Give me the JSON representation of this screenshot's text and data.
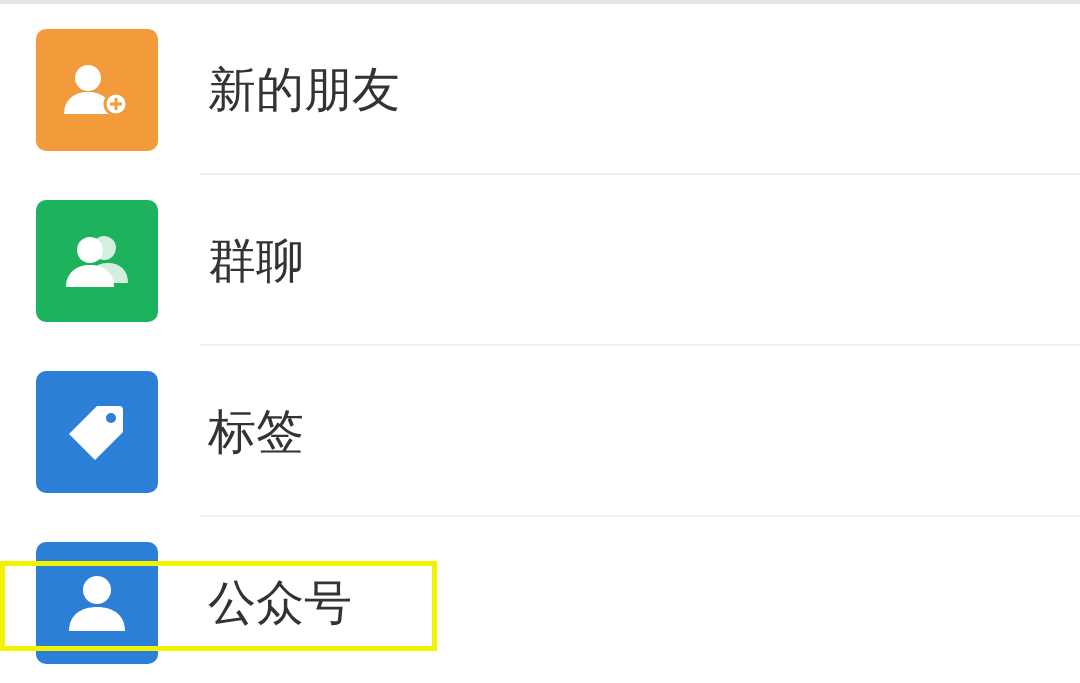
{
  "contact_menu": [
    {
      "kind": "new-friends",
      "label": "新的朋友",
      "color": "#f39a3b",
      "highlighted": false
    },
    {
      "kind": "group-chat",
      "label": "群聊",
      "color": "#1db35d",
      "highlighted": false
    },
    {
      "kind": "tags",
      "label": "标签",
      "color": "#2c7fd6",
      "highlighted": false
    },
    {
      "kind": "official-accounts",
      "label": "公众号",
      "color": "#2c7fd6",
      "highlighted": true
    }
  ]
}
